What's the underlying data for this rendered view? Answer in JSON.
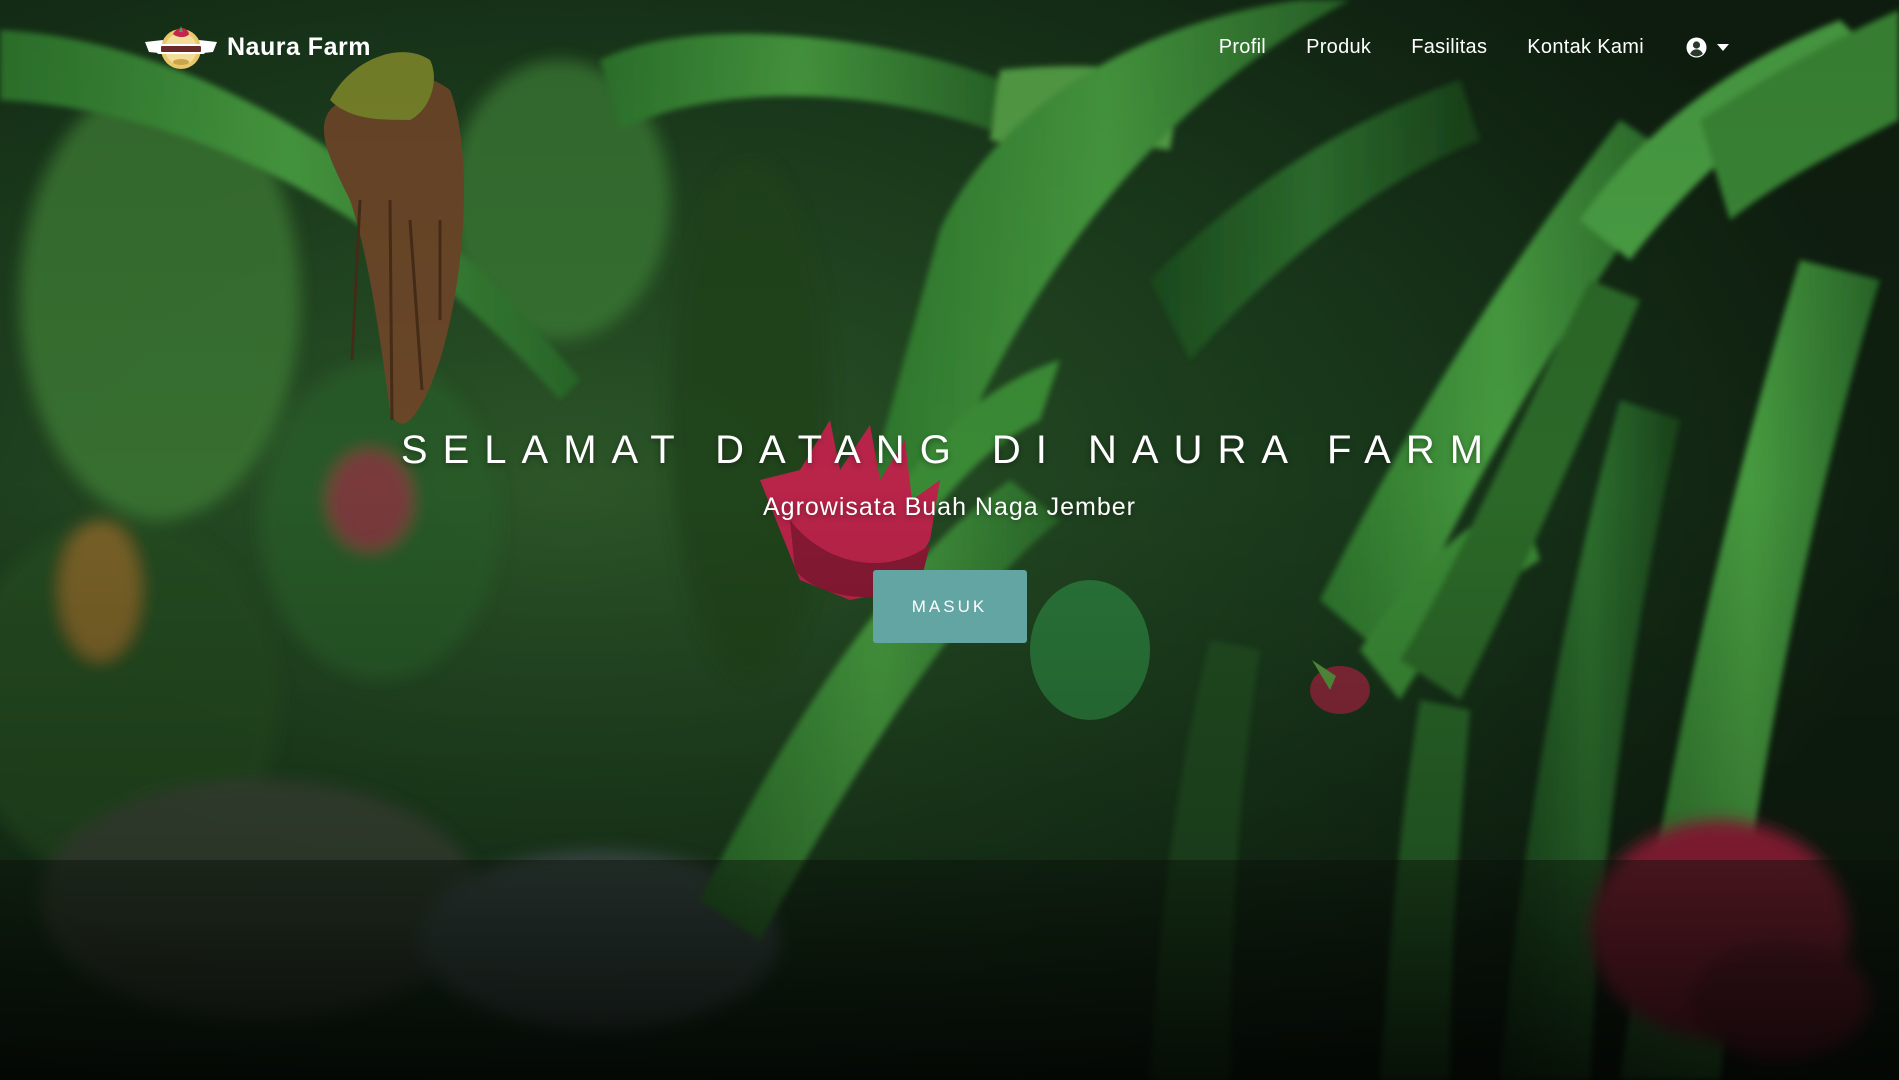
{
  "brand": {
    "name": "Naura Farm",
    "logo_icon": "naura-farm-logo"
  },
  "nav": {
    "items": [
      {
        "label": "Profil"
      },
      {
        "label": "Produk"
      },
      {
        "label": "Fasilitas"
      },
      {
        "label": "Kontak Kami"
      }
    ],
    "user_icon": "user-circle-icon",
    "caret_icon": "caret-down-icon"
  },
  "hero": {
    "title": "SELAMAT DATANG DI NAURA FARM",
    "subtitle": "Agrowisata Buah Naga Jember",
    "button_label": "MASUK"
  },
  "colors": {
    "button_bg": "#62a5a2",
    "text": "#ffffff",
    "foliage_dark": "#13301a",
    "foliage_light": "#3f8f3a",
    "dragon_fruit": "#c3264d"
  }
}
